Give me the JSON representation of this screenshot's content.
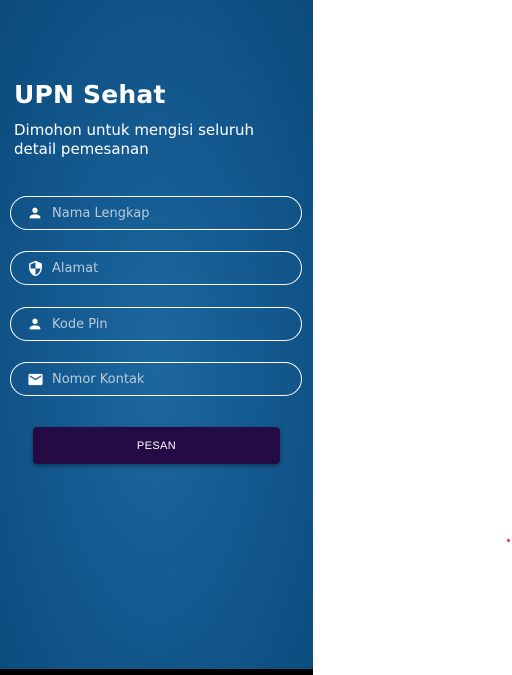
{
  "app": {
    "title": "UPN Sehat",
    "subtitle": "Dimohon untuk mengisi seluruh detail pemesanan"
  },
  "form": {
    "fields": [
      {
        "placeholder": "Nama Lengkap",
        "value": "",
        "icon": "person-icon"
      },
      {
        "placeholder": "Alamat",
        "value": "",
        "icon": "shield-icon"
      },
      {
        "placeholder": "Kode Pin",
        "value": "",
        "icon": "person-icon"
      },
      {
        "placeholder": "Nomor Kontak",
        "value": "",
        "icon": "mail-icon"
      }
    ],
    "submit_label": "PESAN"
  },
  "colors": {
    "background": "#145a90",
    "button": "#240b45",
    "text": "#ffffff"
  }
}
